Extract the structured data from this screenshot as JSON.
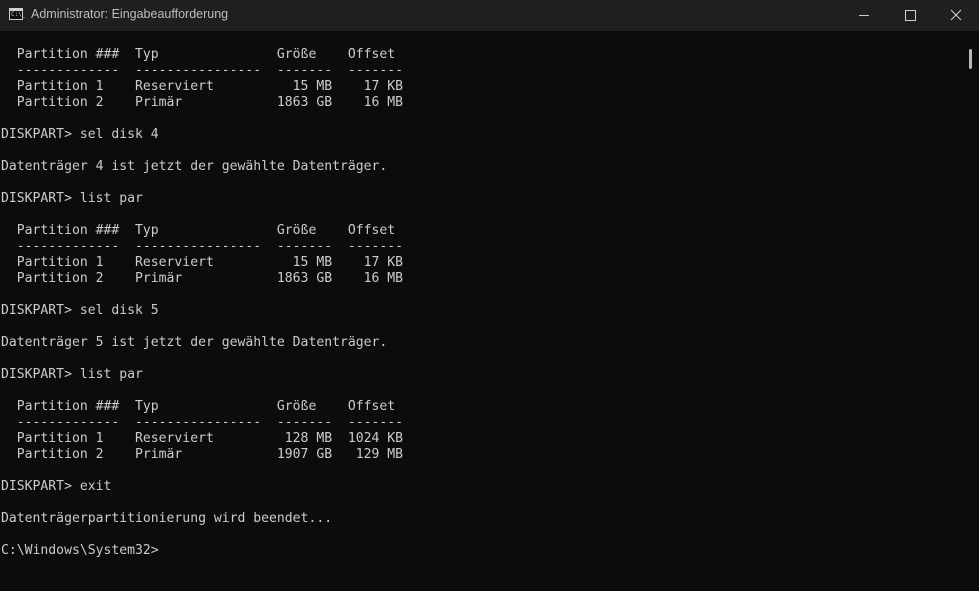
{
  "window": {
    "title": "Administrator: Eingabeaufforderung"
  },
  "titlebar_icons": {
    "app": "cmd-icon",
    "app_glyph": "C:\\_",
    "minimize": "minimize-icon",
    "maximize": "maximize-icon",
    "close": "close-icon"
  },
  "console": {
    "lines": [
      "  Partition ###  Typ               Größe    Offset",
      "  -------------  ----------------  -------  -------",
      "  Partition 1    Reserviert          15 MB    17 KB",
      "  Partition 2    Primär            1863 GB    16 MB",
      "",
      "DISKPART> sel disk 4",
      "",
      "Datenträger 4 ist jetzt der gewählte Datenträger.",
      "",
      "DISKPART> list par",
      "",
      "  Partition ###  Typ               Größe    Offset",
      "  -------------  ----------------  -------  -------",
      "  Partition 1    Reserviert          15 MB    17 KB",
      "  Partition 2    Primär            1863 GB    16 MB",
      "",
      "DISKPART> sel disk 5",
      "",
      "Datenträger 5 ist jetzt der gewählte Datenträger.",
      "",
      "DISKPART> list par",
      "",
      "  Partition ###  Typ               Größe    Offset",
      "  -------------  ----------------  -------  -------",
      "  Partition 1    Reserviert         128 MB  1024 KB",
      "  Partition 2    Primär            1907 GB   129 MB",
      "",
      "DISKPART> exit",
      "",
      "Datenträgerpartitionierung wird beendet...",
      "",
      "C:\\Windows\\System32>"
    ]
  },
  "colors": {
    "console_background": "#0c0c0c",
    "console_text": "#cccccc",
    "titlebar_background": "#1f1f1f"
  }
}
